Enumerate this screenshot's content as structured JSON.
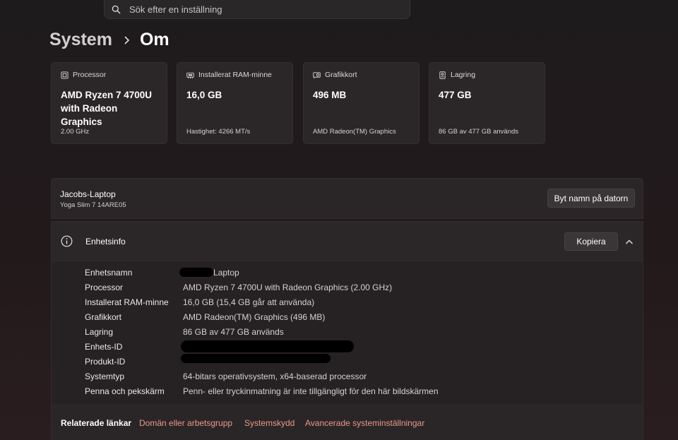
{
  "search": {
    "placeholder": "Sök efter en inställning"
  },
  "breadcrumb": {
    "parent": "System",
    "current": "Om"
  },
  "cards": [
    {
      "label": "Processor",
      "value": "AMD Ryzen 7 4700U with Radeon Graphics",
      "sub": "2.00 GHz",
      "icon": "processor-icon"
    },
    {
      "label": "Installerat RAM-minne",
      "value": "16,0 GB",
      "sub": "Hastighet: 4266 MT/s",
      "icon": "ram-icon"
    },
    {
      "label": "Grafikkort",
      "value": "496 MB",
      "sub": "AMD Radeon(TM) Graphics",
      "icon": "graphics-card-icon"
    },
    {
      "label": "Lagring",
      "value": "477 GB",
      "sub": "86 GB av 477 GB används",
      "icon": "storage-icon"
    }
  ],
  "device": {
    "name": "Jacobs-Laptop",
    "model": "Yoga Slim 7 14ARE05",
    "rename_label": "Byt namn på datorn"
  },
  "specs": {
    "title": "Enhetsinfo",
    "copy_label": "Kopiera",
    "rows": [
      {
        "key": "Enhetsnamn",
        "value": "Laptop"
      },
      {
        "key": "Processor",
        "value": "AMD Ryzen 7 4700U with Radeon Graphics (2.00 GHz)"
      },
      {
        "key": "Installerat RAM-minne",
        "value": "16,0 GB (15,4 GB går att använda)"
      },
      {
        "key": "Grafikkort",
        "value": "AMD Radeon(TM) Graphics (496 MB)"
      },
      {
        "key": "Lagring",
        "value": "86 GB av 477 GB används"
      },
      {
        "key": "Enhets-ID",
        "value": ""
      },
      {
        "key": "Produkt-ID",
        "value": ""
      },
      {
        "key": "Systemtyp",
        "value": "64-bitars operativsystem, x64-baserad processor"
      },
      {
        "key": "Penna och pekskärm",
        "value": "Penn- eller tryckinmatning är inte tillgängligt för den här bildskärmen"
      }
    ]
  },
  "related": {
    "label": "Relaterade länkar",
    "links": [
      "Domän eller arbetsgrupp",
      "Systemskydd",
      "Avancerade systeminställningar"
    ]
  },
  "colors": {
    "link": "#ea9a86",
    "card_bg": "#2b2729",
    "panel_bg": "#2a2628"
  }
}
